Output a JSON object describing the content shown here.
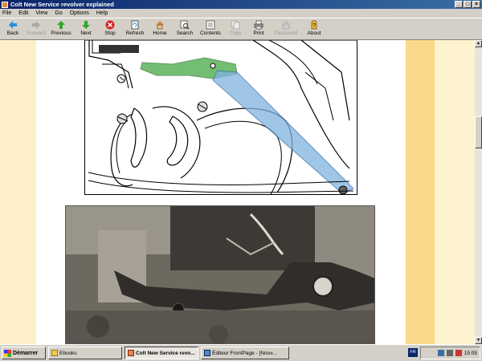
{
  "window": {
    "title": "Colt New Service revolver explained",
    "controls": [
      "_",
      "□",
      "×"
    ]
  },
  "menu": [
    "File",
    "Edit",
    "View",
    "Go",
    "Options",
    "Help"
  ],
  "toolbar": [
    {
      "label": "Back",
      "icon": "back-arrow-icon",
      "enabled": true
    },
    {
      "label": "Forward",
      "icon": "forward-arrow-icon",
      "enabled": false
    },
    {
      "label": "Previous",
      "icon": "previous-arrow-icon",
      "enabled": true
    },
    {
      "label": "Next",
      "icon": "next-arrow-icon",
      "enabled": true
    },
    {
      "label": "Stop",
      "icon": "stop-icon",
      "enabled": true
    },
    {
      "label": "Refresh",
      "icon": "refresh-icon",
      "enabled": true
    },
    {
      "label": "Home",
      "icon": "home-icon",
      "enabled": true
    },
    {
      "label": "Search",
      "icon": "search-icon",
      "enabled": true
    },
    {
      "label": "Contents",
      "icon": "contents-icon",
      "enabled": true
    },
    {
      "label": "Copy",
      "icon": "copy-icon",
      "enabled": false
    },
    {
      "label": "Print",
      "icon": "print-icon",
      "enabled": true
    },
    {
      "label": "Password",
      "icon": "password-icon",
      "enabled": false
    },
    {
      "label": "About",
      "icon": "about-icon",
      "enabled": true
    }
  ],
  "taskbar": {
    "start_label": "Démarrer",
    "tasks": [
      {
        "label": "Ebooks",
        "active": false
      },
      {
        "label": "Colt New Service revo...",
        "active": true
      },
      {
        "label": "Éditeur FrontPage - [Nouv...",
        "active": false
      }
    ],
    "lang": "FR",
    "clock": "15:05"
  },
  "colors": {
    "page_background": "#ffffff",
    "side_band": "#fcd98a",
    "lever_green": "#3aa33a",
    "lever_blue": "#7fb2e0"
  }
}
